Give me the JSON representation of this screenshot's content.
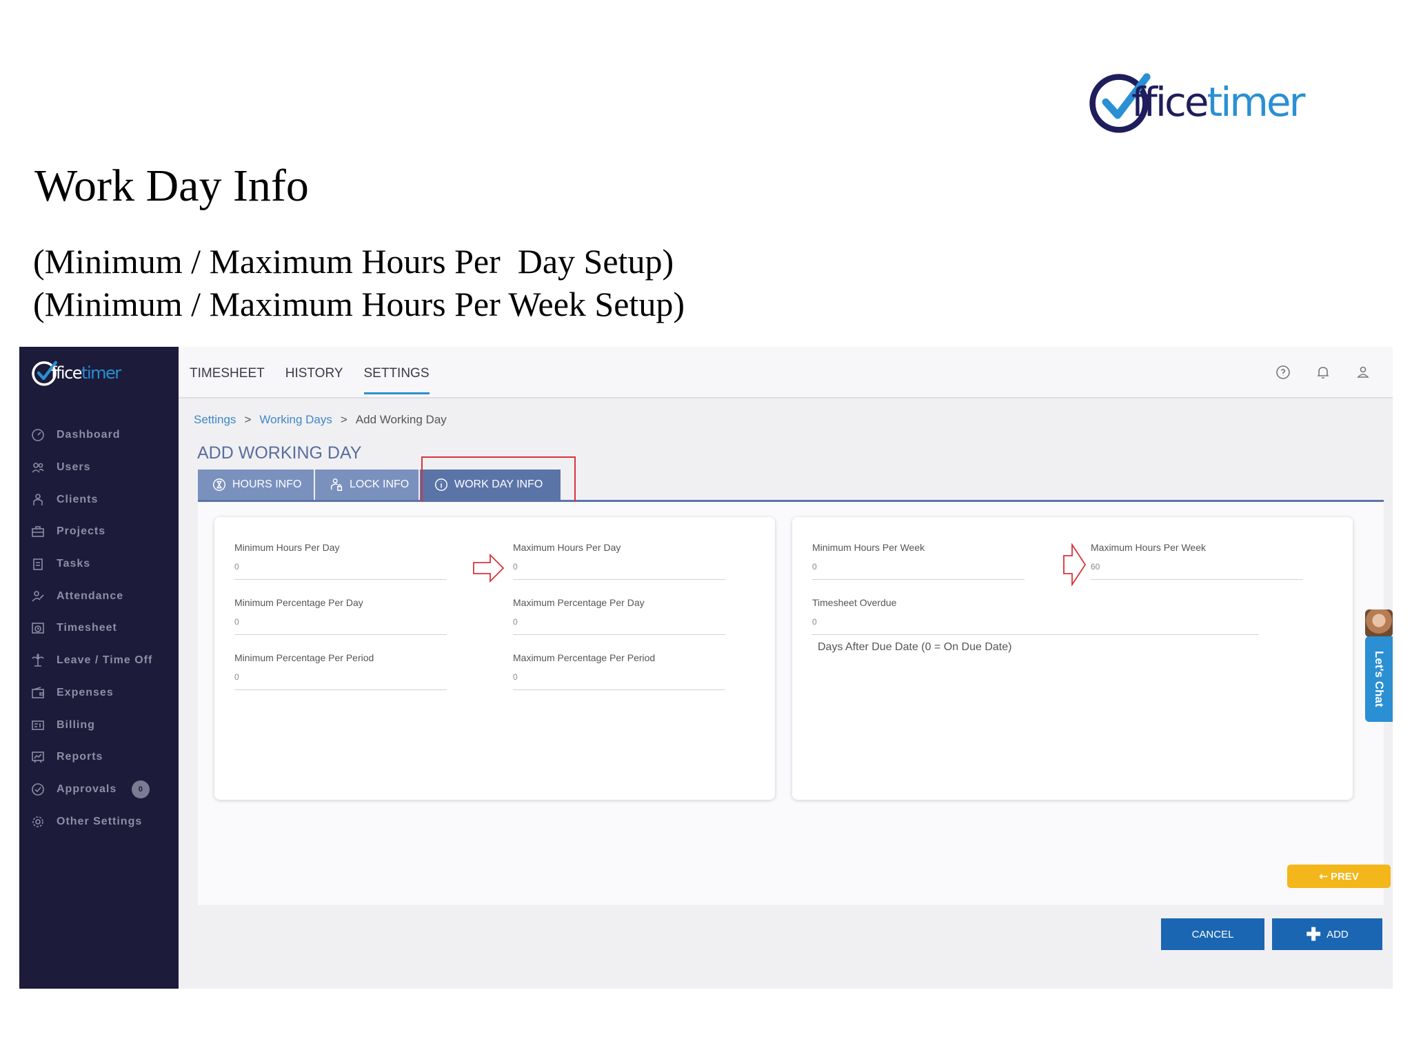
{
  "slide": {
    "title": "Work Day Info",
    "subtitle_day": "(Minimum / Maximum Hours Per  Day Setup)",
    "subtitle_week": "(Minimum / Maximum Hours Per Week Setup)",
    "logo": {
      "brand_prefix": "ffice",
      "brand_suffix": "timer",
      "colors": {
        "navy": "#1f1d5c",
        "blue": "#2a8fd3"
      }
    }
  },
  "app": {
    "logo": {
      "brand_prefix": "ffice",
      "brand_suffix": "timer"
    },
    "top_tabs": [
      {
        "label": "TIMESHEET"
      },
      {
        "label": "HISTORY"
      },
      {
        "label": "SETTINGS",
        "active": true
      }
    ],
    "top_icons": [
      "help-icon",
      "bell-icon",
      "user-icon"
    ],
    "sidebar": [
      {
        "label": "Dashboard",
        "icon": "gauge-icon"
      },
      {
        "label": "Users",
        "icon": "users-icon"
      },
      {
        "label": "Clients",
        "icon": "clients-icon"
      },
      {
        "label": "Projects",
        "icon": "briefcase-icon"
      },
      {
        "label": "Tasks",
        "icon": "clipboard-icon"
      },
      {
        "label": "Attendance",
        "icon": "attendance-icon"
      },
      {
        "label": "Timesheet",
        "icon": "timesheet-icon"
      },
      {
        "label": "Leave / Time Off",
        "icon": "palm-tree-icon"
      },
      {
        "label": "Expenses",
        "icon": "wallet-icon"
      },
      {
        "label": "Billing",
        "icon": "billing-icon"
      },
      {
        "label": "Reports",
        "icon": "reports-icon"
      },
      {
        "label": "Approvals",
        "icon": "check-circle-icon",
        "badge": "0"
      },
      {
        "label": "Other Settings",
        "icon": "gear-icon"
      }
    ],
    "breadcrumb": {
      "items": [
        "Settings",
        "Working Days",
        "Add Working Day"
      ],
      "separator": ">"
    },
    "page_title": "ADD WORKING DAY",
    "tabs": [
      {
        "label": "HOURS INFO",
        "icon": "hourglass-icon"
      },
      {
        "label": "LOCK INFO",
        "icon": "lock-person-icon"
      },
      {
        "label": "WORK DAY INFO",
        "icon": "info-icon",
        "active": true
      }
    ],
    "day_card": {
      "min_hours_day": {
        "label": "Minimum Hours Per Day",
        "value": "0"
      },
      "max_hours_day": {
        "label": "Maximum Hours Per Day",
        "value": "0"
      },
      "min_pct_day": {
        "label": "Minimum Percentage Per Day",
        "value": "0"
      },
      "max_pct_day": {
        "label": "Maximum Percentage Per Day",
        "value": "0"
      },
      "min_pct_period": {
        "label": "Minimum Percentage Per Period",
        "value": "0"
      },
      "max_pct_period": {
        "label": "Maximum Percentage Per Period",
        "value": "0"
      }
    },
    "week_card": {
      "min_hours_week": {
        "label": "Minimum Hours Per Week",
        "value": "0"
      },
      "max_hours_week": {
        "label": "Maximum Hours Per Week",
        "value": "60"
      },
      "timesheet_overdue": {
        "label": "Timesheet Overdue",
        "value": "0"
      },
      "overdue_note": "Days After Due Date (0 = On Due Date)"
    },
    "buttons": {
      "prev": "⇠ PREV",
      "cancel": "CANCEL",
      "add_plus": "✚",
      "add": "ADD"
    },
    "chat": {
      "label": "Let's Chat"
    },
    "colors": {
      "sidebar_bg": "#1c1b3a",
      "tab_active": "#5b74a8",
      "tab_inactive": "#7a91be",
      "primary_button": "#1b66b2",
      "prev_button": "#f3b71b",
      "highlight_red": "#d9333a"
    }
  }
}
